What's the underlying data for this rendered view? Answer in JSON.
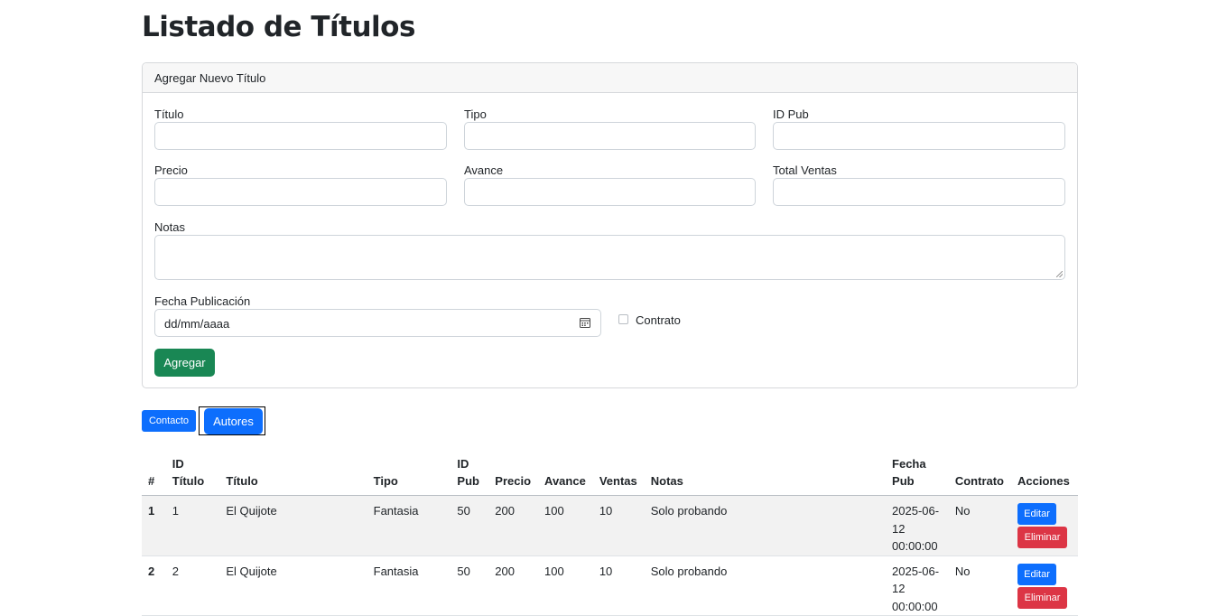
{
  "page": {
    "title": "Listado de Títulos"
  },
  "form": {
    "header": "Agregar Nuevo Título",
    "fields": {
      "titulo": {
        "label": "Título",
        "value": ""
      },
      "tipo": {
        "label": "Tipo",
        "value": ""
      },
      "id_pub": {
        "label": "ID Pub",
        "value": ""
      },
      "precio": {
        "label": "Precio",
        "value": ""
      },
      "avance": {
        "label": "Avance",
        "value": ""
      },
      "total_ventas": {
        "label": "Total Ventas",
        "value": ""
      },
      "notas": {
        "label": "Notas",
        "value": ""
      },
      "fecha": {
        "label": "Fecha Publicación",
        "placeholder": "dd/mm/aaaa"
      },
      "contrato": {
        "label": "Contrato",
        "checked": false
      }
    },
    "submit_label": "Agregar"
  },
  "nav": {
    "contacto_label": "Contacto",
    "autores_label": "Autores"
  },
  "table": {
    "headers": {
      "num": "#",
      "id_titulo": [
        "ID",
        "Título"
      ],
      "titulo": "Título",
      "tipo": "Tipo",
      "id_pub": [
        "ID",
        "Pub"
      ],
      "precio": "Precio",
      "avance": "Avance",
      "ventas": "Ventas",
      "notas": "Notas",
      "fecha_pub": [
        "Fecha",
        "Pub"
      ],
      "contrato": "Contrato",
      "acciones": "Acciones"
    },
    "rows": [
      {
        "num": "1",
        "id_titulo": "1",
        "titulo": "El Quijote",
        "tipo": "Fantasia",
        "id_pub": "50",
        "precio": "200",
        "avance": "100",
        "ventas": "10",
        "notas": "Solo probando",
        "fecha_pub": [
          "2025-06-",
          "12",
          "00:00:00"
        ],
        "contrato": "No",
        "edit_label": "Editar",
        "delete_label": "Eliminar"
      },
      {
        "num": "2",
        "id_titulo": "2",
        "titulo": "El Quijote",
        "tipo": "Fantasia",
        "id_pub": "50",
        "precio": "200",
        "avance": "100",
        "ventas": "10",
        "notas": "Solo probando",
        "fecha_pub": [
          "2025-06-",
          "12",
          "00:00:00"
        ],
        "contrato": "No",
        "edit_label": "Editar",
        "delete_label": "Eliminar"
      }
    ]
  },
  "colors": {
    "primary": "#0d6efd",
    "success": "#198754",
    "danger": "#dc3545",
    "stripe": "#f2f2f2"
  },
  "icons": {
    "date_picker": "calendar-icon"
  }
}
